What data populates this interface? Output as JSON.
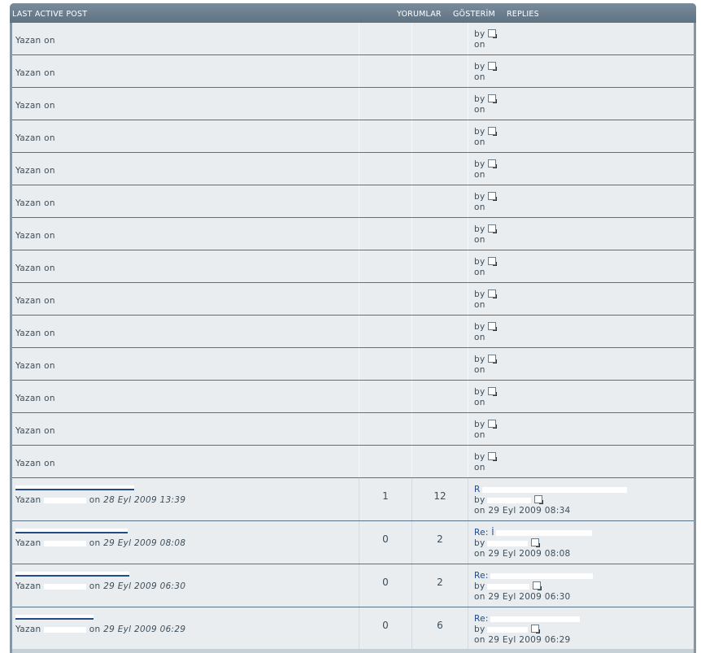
{
  "header": {
    "last_active_post": "LAST ACTIVE POST",
    "yorumlar": "YORUMLAR",
    "gosterim": "GÖSTERİM",
    "replies": "REPLIES"
  },
  "empty_row": {
    "author_prefix": "Yazan",
    "on": "on",
    "by": "by",
    "last_on": "on"
  },
  "topics": [
    {
      "author_prefix": "Yazan",
      "date": "28 Eyl 2009 13:39",
      "replies": "1",
      "views": "12",
      "last_title": "R",
      "last_by": "by",
      "last_on": "on 29 Eyl 2009 08:34"
    },
    {
      "author_prefix": "Yazan",
      "date": "29 Eyl 2009 08:08",
      "replies": "0",
      "views": "2",
      "last_title": "Re: İ",
      "last_by": "by",
      "last_on": "on 29 Eyl 2009 08:08"
    },
    {
      "author_prefix": "Yazan",
      "date": "29 Eyl 2009 06:30",
      "replies": "0",
      "views": "2",
      "last_title": "Re:",
      "last_by": "by",
      "last_on": "on 29 Eyl 2009 06:30"
    },
    {
      "author_prefix": "Yazan",
      "date": "29 Eyl 2009 06:29",
      "replies": "0",
      "views": "6",
      "last_title": "Re:",
      "last_by": "by",
      "last_on": "on 29 Eyl 2009 06:29"
    }
  ],
  "icons": {
    "last_post": "last-post-icon"
  }
}
